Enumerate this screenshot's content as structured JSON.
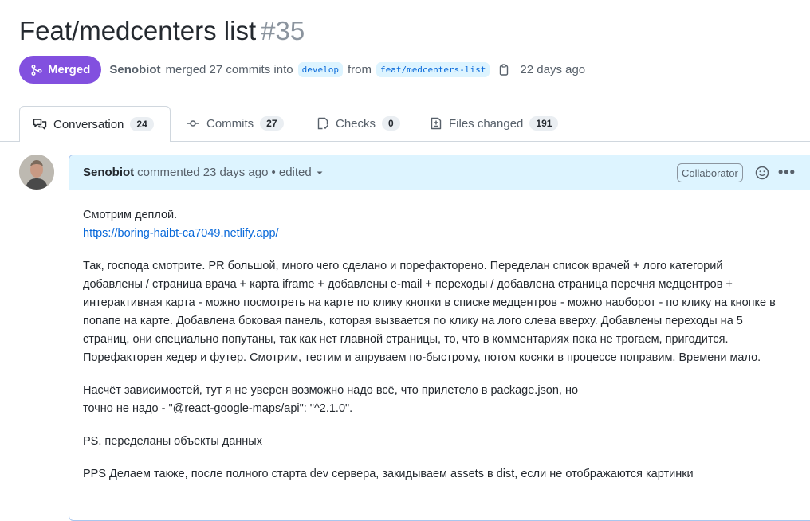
{
  "pr": {
    "title": "Feat/medcenters list",
    "number": "#35",
    "state": "Merged",
    "author": "Senobiot",
    "merged_text": "merged 27 commits into",
    "base_branch": "develop",
    "from_text": "from",
    "head_branch": "feat/medcenters-list",
    "age": "22 days ago",
    "state_color": "#8250df"
  },
  "tabs": [
    {
      "label": "Conversation",
      "count": "24",
      "icon": "comment-discussion-icon"
    },
    {
      "label": "Commits",
      "count": "27",
      "icon": "git-commit-icon"
    },
    {
      "label": "Checks",
      "count": "0",
      "icon": "checklist-icon"
    },
    {
      "label": "Files changed",
      "count": "191",
      "icon": "file-diff-icon"
    }
  ],
  "comment": {
    "author": "Senobiot",
    "meta": "commented 23 days ago",
    "edited": "• edited",
    "role_badge": "Collaborator",
    "body": {
      "p1_line1": "Смотрим деплой.",
      "p1_link": "https://boring-haibt-ca7049.netlify.app/",
      "p2": "Так, господа смотрите. PR большой, много чего сделано и порефакторено. Переделан список врачей + лого категорий добавлены / страница врача + карта iframe + добавлены e-mail + переходы / добавлена страница перечня медцентров + интерактивная карта - можно посмотреть на карте по клику кнопки в списке медцентров - можно наоборот - по клику на кнопке в попапе на карте. Добавлена боковая панель, которая вызвается по клику на лого слева вверху. Добавлены переходы на 5 страниц, они специально попутаны, так как нет главной страницы, то, что в комментариях пока не трогаем, пригодится. Порефакторен хедер и футер. Смотрим, тестим и апруваем по-быстрому, потом косяки в процессе поправим. Времени мало.",
      "p3_line1": "Насчёт зависимостей, тут я не уверен возможно надо всё, что прилетело в package.json, но",
      "p3_line2": "точно не надо - \"@react-google-maps/api\": \"^2.1.0\".",
      "p4": "PS. переделаны объекты данных",
      "p5": "PPS Делаем также, после полного старта dev сервера, закидываем assets в dist, если не отображаются картинки"
    }
  }
}
